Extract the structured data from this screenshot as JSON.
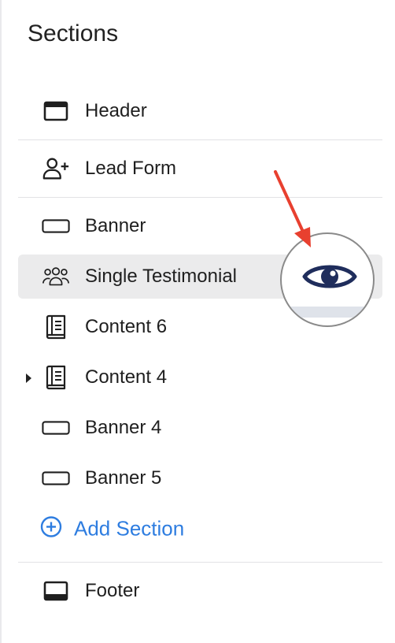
{
  "panel": {
    "title": "Sections"
  },
  "sections": [
    {
      "label": "Header",
      "icon": "header-icon"
    },
    {
      "label": "Lead Form",
      "icon": "add-user-icon"
    },
    {
      "label": "Banner",
      "icon": "banner-icon"
    },
    {
      "label": "Single Testimonial",
      "icon": "users-icon",
      "highlighted": true
    },
    {
      "label": "Content 6",
      "icon": "book-icon"
    },
    {
      "label": "Content 4",
      "icon": "book-icon",
      "collapsed": true
    },
    {
      "label": "Banner 4",
      "icon": "banner-icon"
    },
    {
      "label": "Banner 5",
      "icon": "banner-icon"
    }
  ],
  "add_section": {
    "label": "Add Section",
    "icon": "plus-circle-icon",
    "color": "#2e7de0"
  },
  "footer": {
    "label": "Footer",
    "icon": "footer-icon"
  },
  "annotation": {
    "arrow_color": "#e8402f",
    "eye_icon": "eye-icon",
    "eye_color": "#1f2d5c"
  }
}
